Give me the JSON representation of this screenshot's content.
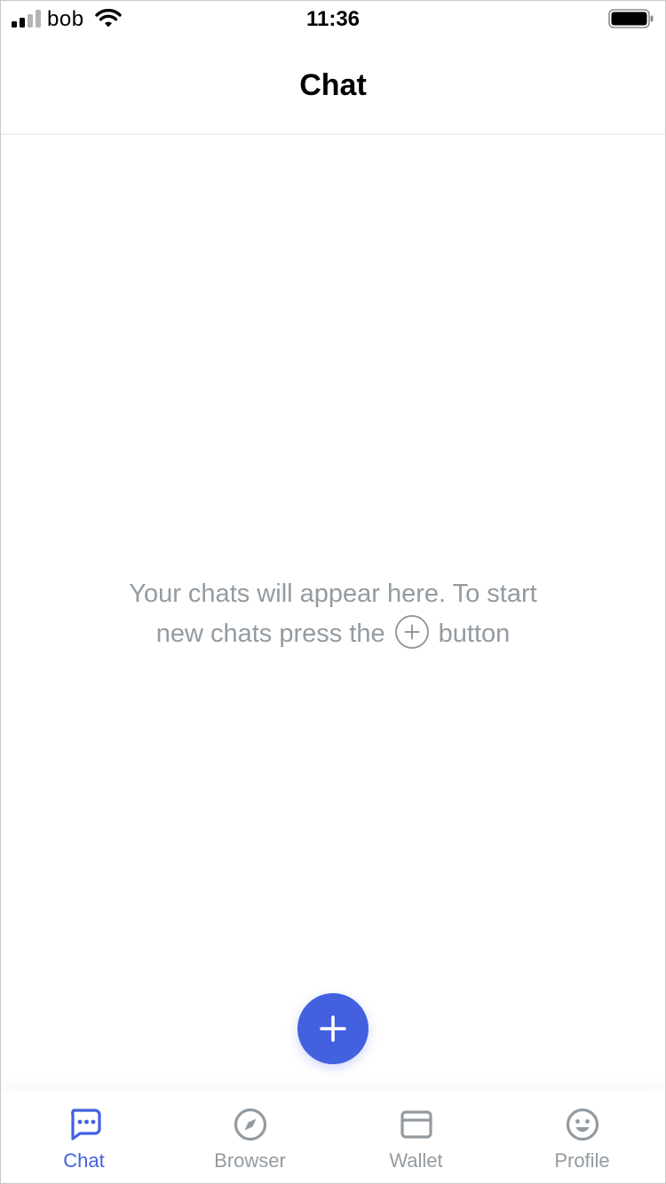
{
  "status_bar": {
    "carrier": "bob",
    "time": "11:36",
    "signal_icon": "cellular-signal-icon",
    "wifi_icon": "wifi-icon",
    "battery_icon": "battery-icon"
  },
  "header": {
    "title": "Chat"
  },
  "empty_state": {
    "line1": "Your chats will appear here. To start",
    "line2_before": "new chats press the",
    "line2_after": "button",
    "inline_icon": "plus-circle-icon"
  },
  "fab": {
    "icon": "plus-icon",
    "color": "#4360df"
  },
  "tabs": [
    {
      "label": "Chat",
      "icon": "chat-bubble-icon",
      "active": true
    },
    {
      "label": "Browser",
      "icon": "compass-icon",
      "active": false
    },
    {
      "label": "Wallet",
      "icon": "wallet-icon",
      "active": false
    },
    {
      "label": "Profile",
      "icon": "smiley-face-icon",
      "active": false
    }
  ],
  "colors": {
    "accent": "#4360df",
    "muted_text": "#939ba1",
    "divider": "#eeeff1"
  }
}
